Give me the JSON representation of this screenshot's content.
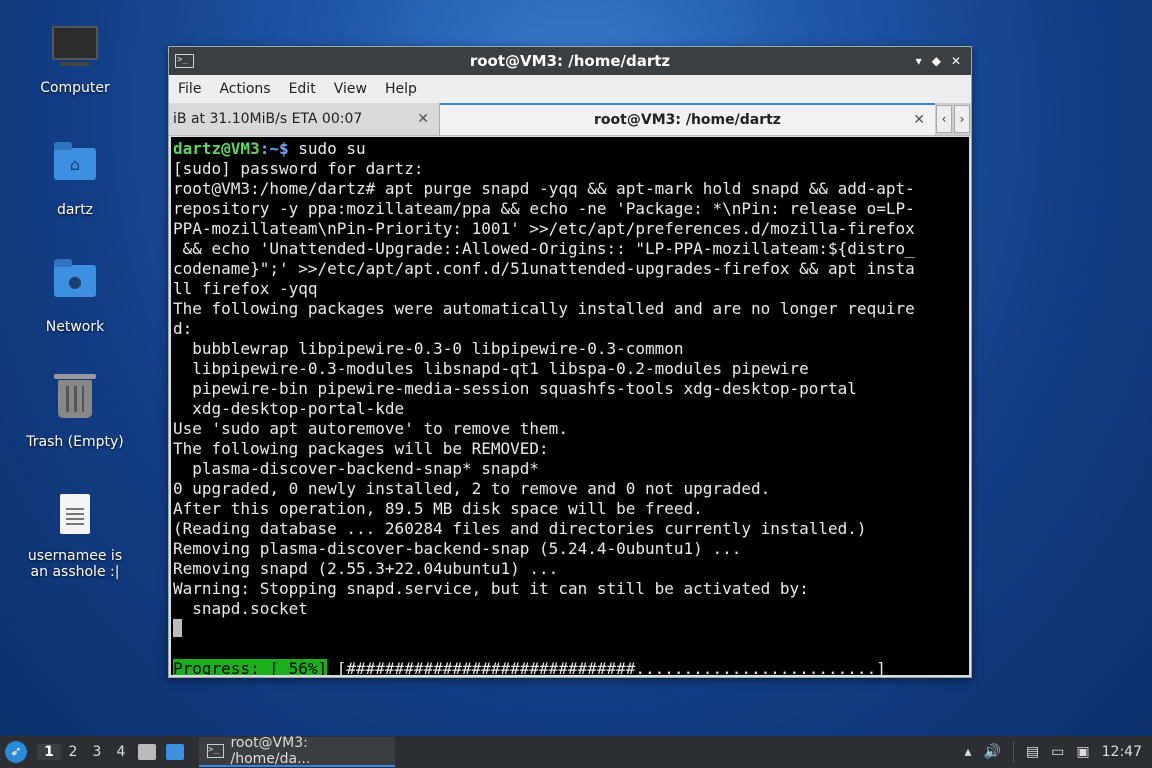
{
  "desktop": {
    "icons": [
      {
        "label": "Computer"
      },
      {
        "label": "dartz"
      },
      {
        "label": "Network"
      },
      {
        "label": "Trash (Empty)"
      },
      {
        "label": "usernamee is an asshole :|"
      }
    ]
  },
  "window": {
    "title": "root@VM3: /home/dartz",
    "controls": [
      "minimize",
      "maximize",
      "close"
    ],
    "menu": [
      "File",
      "Actions",
      "Edit",
      "View",
      "Help"
    ],
    "tabs": [
      {
        "label": "iB at 31.10MiB/s ETA 00:07",
        "active": false
      },
      {
        "label": "root@VM3: /home/dartz",
        "active": true
      }
    ],
    "terminal": {
      "prompt_user": "dartz@VM3",
      "prompt_path": ":~$",
      "command": " sudo su",
      "lines": [
        "[sudo] password for dartz:",
        "root@VM3:/home/dartz# apt purge snapd -yqq && apt-mark hold snapd && add-apt-",
        "repository -y ppa:mozillateam/ppa && echo -ne 'Package: *\\nPin: release o=LP-",
        "PPA-mozillateam\\nPin-Priority: 1001' >>/etc/apt/preferences.d/mozilla-firefox",
        " && echo 'Unattended-Upgrade::Allowed-Origins:: \"LP-PPA-mozillateam:${distro_",
        "codename}\";' >>/etc/apt/apt.conf.d/51unattended-upgrades-firefox && apt insta",
        "ll firefox -yqq",
        "The following packages were automatically installed and are no longer require",
        "d:",
        "  bubblewrap libpipewire-0.3-0 libpipewire-0.3-common",
        "  libpipewire-0.3-modules libsnapd-qt1 libspa-0.2-modules pipewire",
        "  pipewire-bin pipewire-media-session squashfs-tools xdg-desktop-portal",
        "  xdg-desktop-portal-kde",
        "Use 'sudo apt autoremove' to remove them.",
        "The following packages will be REMOVED:",
        "  plasma-discover-backend-snap* snapd*",
        "0 upgraded, 0 newly installed, 2 to remove and 0 not upgraded.",
        "After this operation, 89.5 MB disk space will be freed.",
        "(Reading database ... 260284 files and directories currently installed.)",
        "Removing plasma-discover-backend-snap (5.24.4-0ubuntu1) ...",
        "Removing snapd (2.55.3+22.04ubuntu1) ...",
        "Warning: Stopping snapd.service, but it can still be activated by:",
        "  snapd.socket"
      ],
      "progress_label": "Progress: [ 56%]",
      "progress_bar": " [##############################.........................]",
      "progress_percent": 56
    }
  },
  "taskbar": {
    "workspaces": [
      "1",
      "2",
      "3",
      "4"
    ],
    "task_label": "root@VM3: /home/da...",
    "clock": "12:47"
  }
}
